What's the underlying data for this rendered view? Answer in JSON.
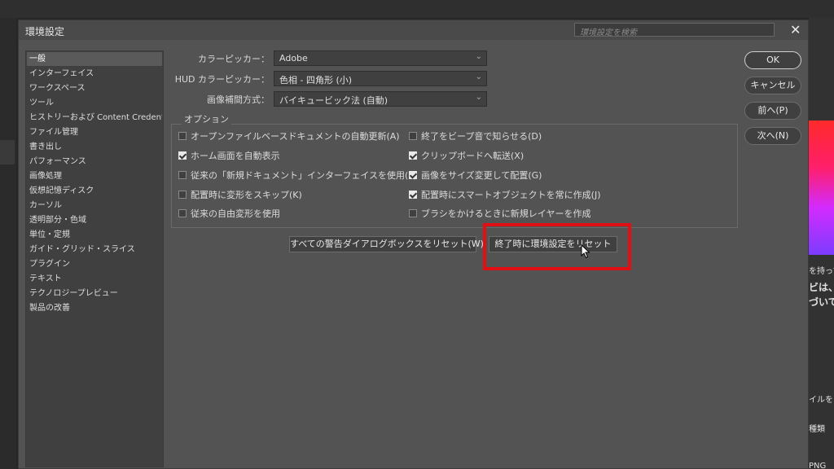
{
  "dialog": {
    "title": "環境設定",
    "search_placeholder": "環境設定を検索",
    "close_glyph": "✕"
  },
  "sidebar": {
    "items": [
      {
        "label": "一般",
        "selected": true
      },
      {
        "label": "インターフェイス"
      },
      {
        "label": "ワークスペース"
      },
      {
        "label": "ツール"
      },
      {
        "label": "ヒストリーおよび Content Credentials"
      },
      {
        "label": "ファイル管理"
      },
      {
        "label": "書き出し"
      },
      {
        "label": "パフォーマンス"
      },
      {
        "label": "画像処理"
      },
      {
        "label": "仮想記憶ディスク"
      },
      {
        "label": "カーソル"
      },
      {
        "label": "透明部分・色域"
      },
      {
        "label": "単位・定規"
      },
      {
        "label": "ガイド・グリッド・スライス"
      },
      {
        "label": "プラグイン"
      },
      {
        "label": "テキスト"
      },
      {
        "label": "テクノロジープレビュー"
      },
      {
        "label": "製品の改善"
      }
    ]
  },
  "fields": {
    "color_picker_label": "カラーピッカー：",
    "color_picker_value": "Adobe",
    "hud_picker_label": "HUD カラーピッカー：",
    "hud_picker_value": "色相 - 四角形 (小)",
    "interp_label": "画像補間方式：",
    "interp_value": "バイキュービック法 (自動)",
    "chevron": "⌄"
  },
  "options": {
    "title": "オプション",
    "left": [
      {
        "label": "オープンファイルベースドキュメントの自動更新(A)",
        "checked": false
      },
      {
        "label": "ホーム画面を自動表示",
        "checked": true
      },
      {
        "label": "従来の「新規ドキュメント」インターフェイスを使用(L)",
        "checked": false
      },
      {
        "label": "配置時に変形をスキップ(K)",
        "checked": false
      },
      {
        "label": "従来の自由変形を使用",
        "checked": false
      }
    ],
    "right": [
      {
        "label": "終了をビープ音で知らせる(D)",
        "checked": false
      },
      {
        "label": "クリップボードへ転送(X)",
        "checked": true
      },
      {
        "label": "画像をサイズ変更して配置(G)",
        "checked": true
      },
      {
        "label": "配置時にスマートオブジェクトを常に作成(J)",
        "checked": true
      },
      {
        "label": "ブラシをかけるときに新規レイヤーを作成",
        "checked": false
      }
    ]
  },
  "buttons": {
    "ok": "OK",
    "cancel": "キャンセル",
    "prev": "前へ(P)",
    "next": "次へ(N)",
    "reset_warnings": "すべての警告ダイアログボックスをリセット(W)",
    "reset_on_quit": "終了時に環境設定をリセット"
  },
  "background_right": {
    "line1": "を持って",
    "line2": "ビは、",
    "line3": "づいて",
    "line4": "イルを",
    "line5": "種類",
    "line6": "PNG"
  },
  "colors": {
    "highlight": "#e10f14",
    "dialog_bg": "#535353"
  }
}
